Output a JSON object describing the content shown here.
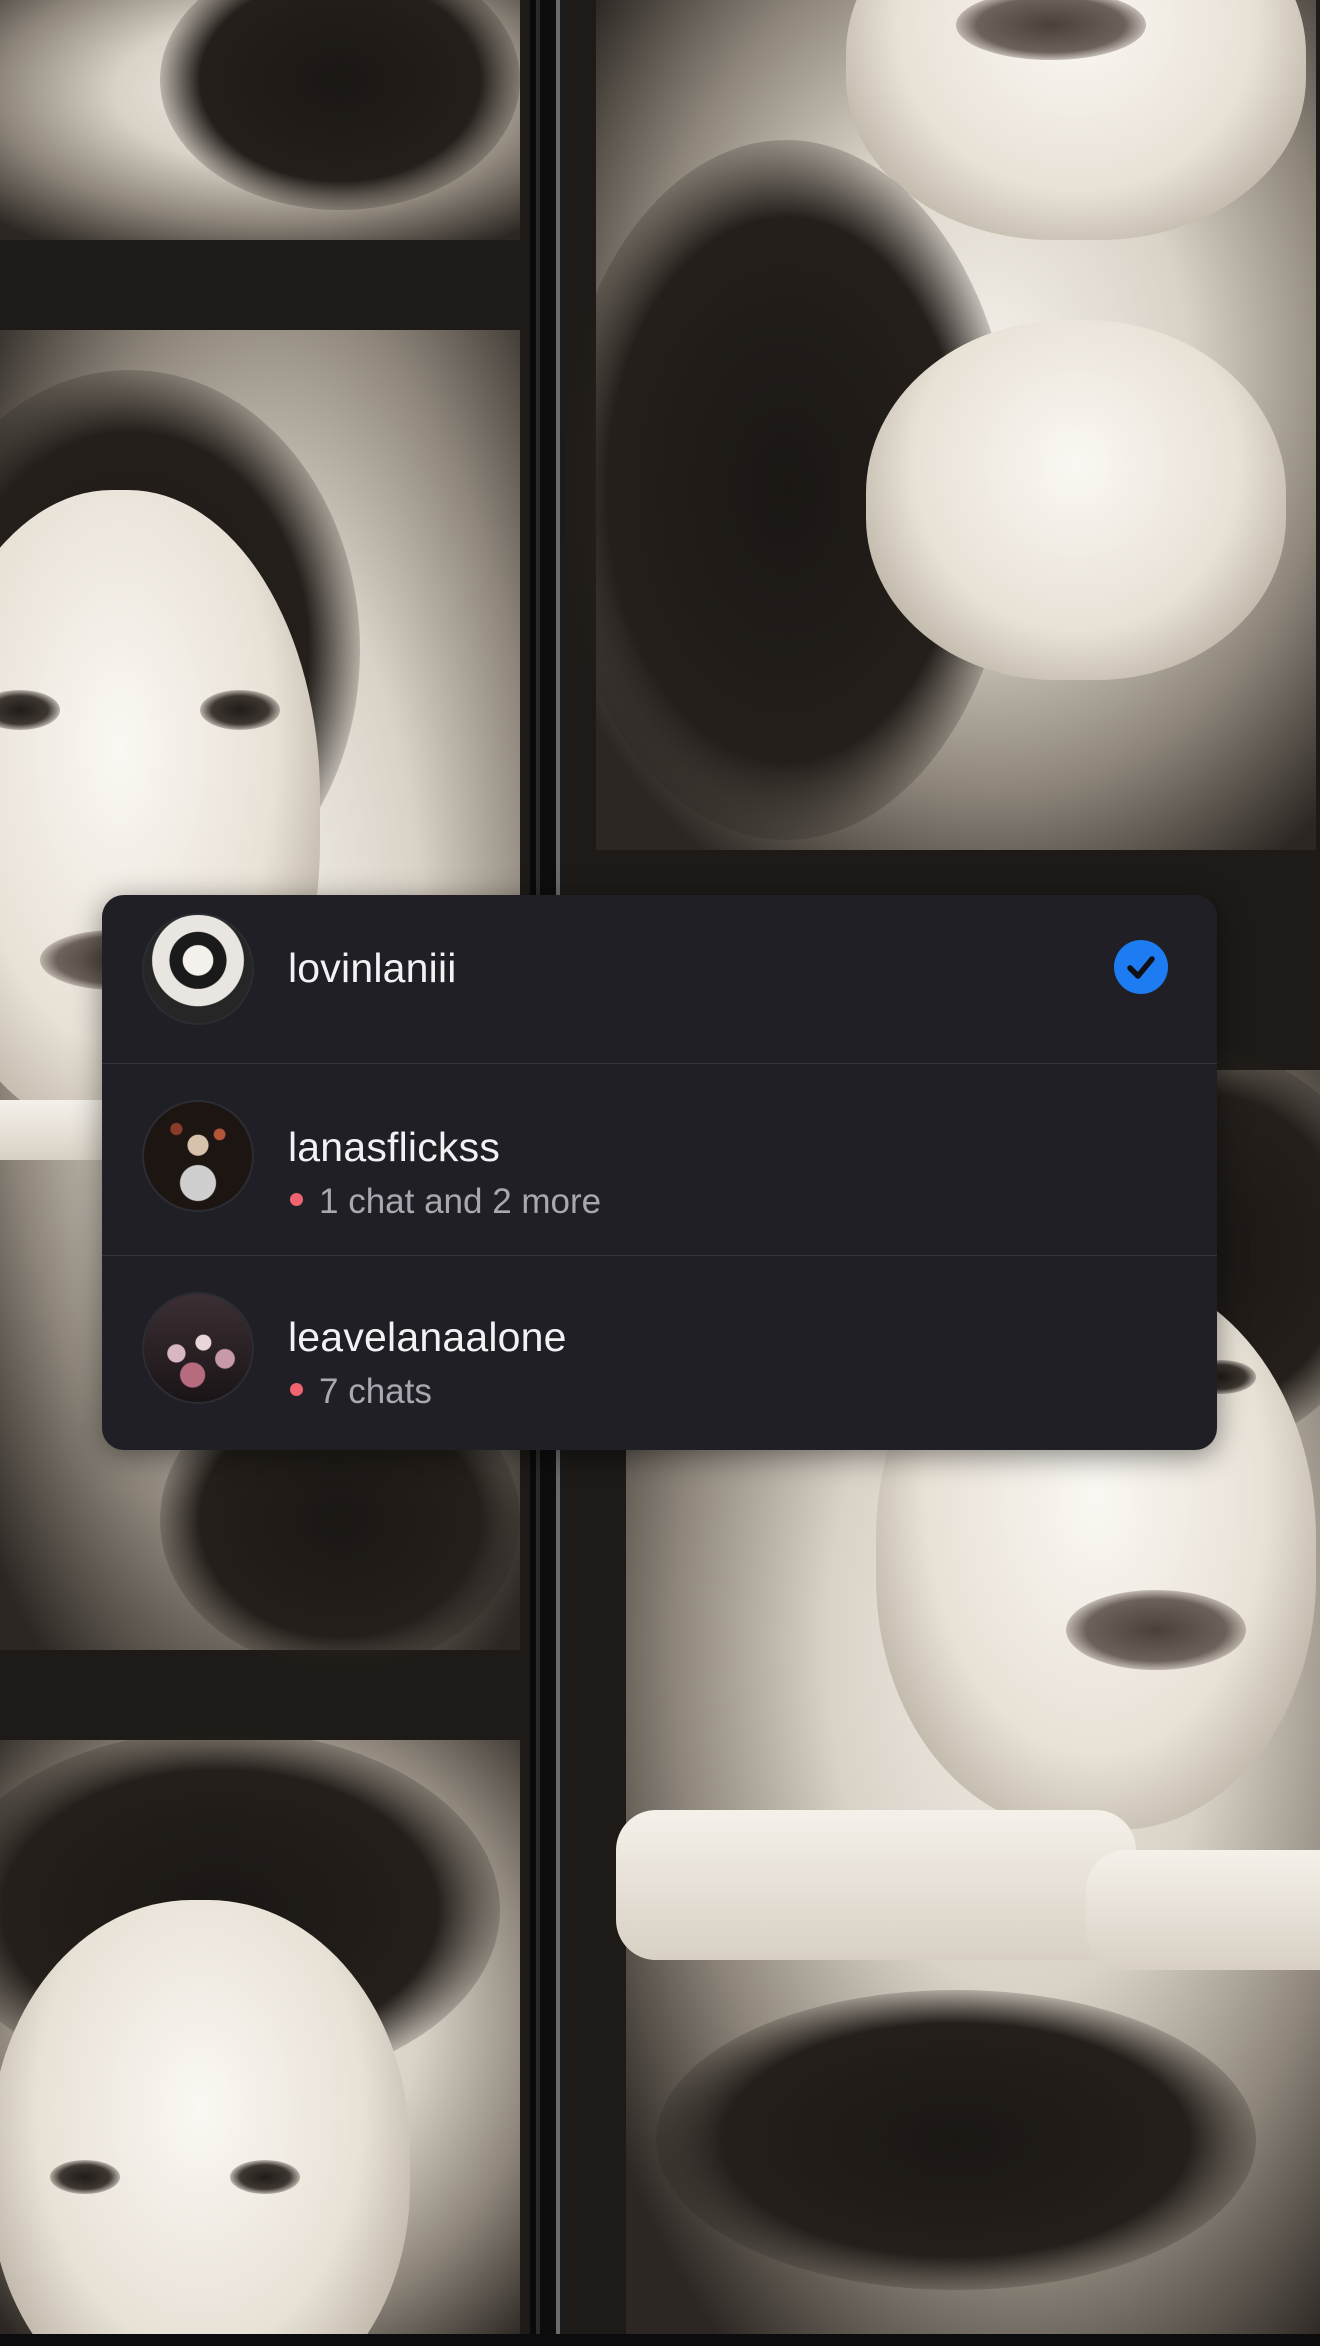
{
  "accounts": [
    {
      "username": "lovinlaniii",
      "subtitle": "",
      "selected": true,
      "avatar": "profile-photo"
    },
    {
      "username": "lanasflickss",
      "subtitle": "1 chat and 2 more",
      "selected": false,
      "avatar": "profile-photo"
    },
    {
      "username": "leavelanaalone",
      "subtitle": "7 chats",
      "selected": false,
      "avatar": "profile-photo"
    }
  ],
  "colors": {
    "sheet_background": "#1f1f25",
    "selected_check": "#1d7cf2",
    "unread_dot": "#f0646f",
    "divider": "#34343c"
  },
  "icons": {
    "selected": "checkmark-circle-icon",
    "unread": "unread-dot-icon"
  }
}
